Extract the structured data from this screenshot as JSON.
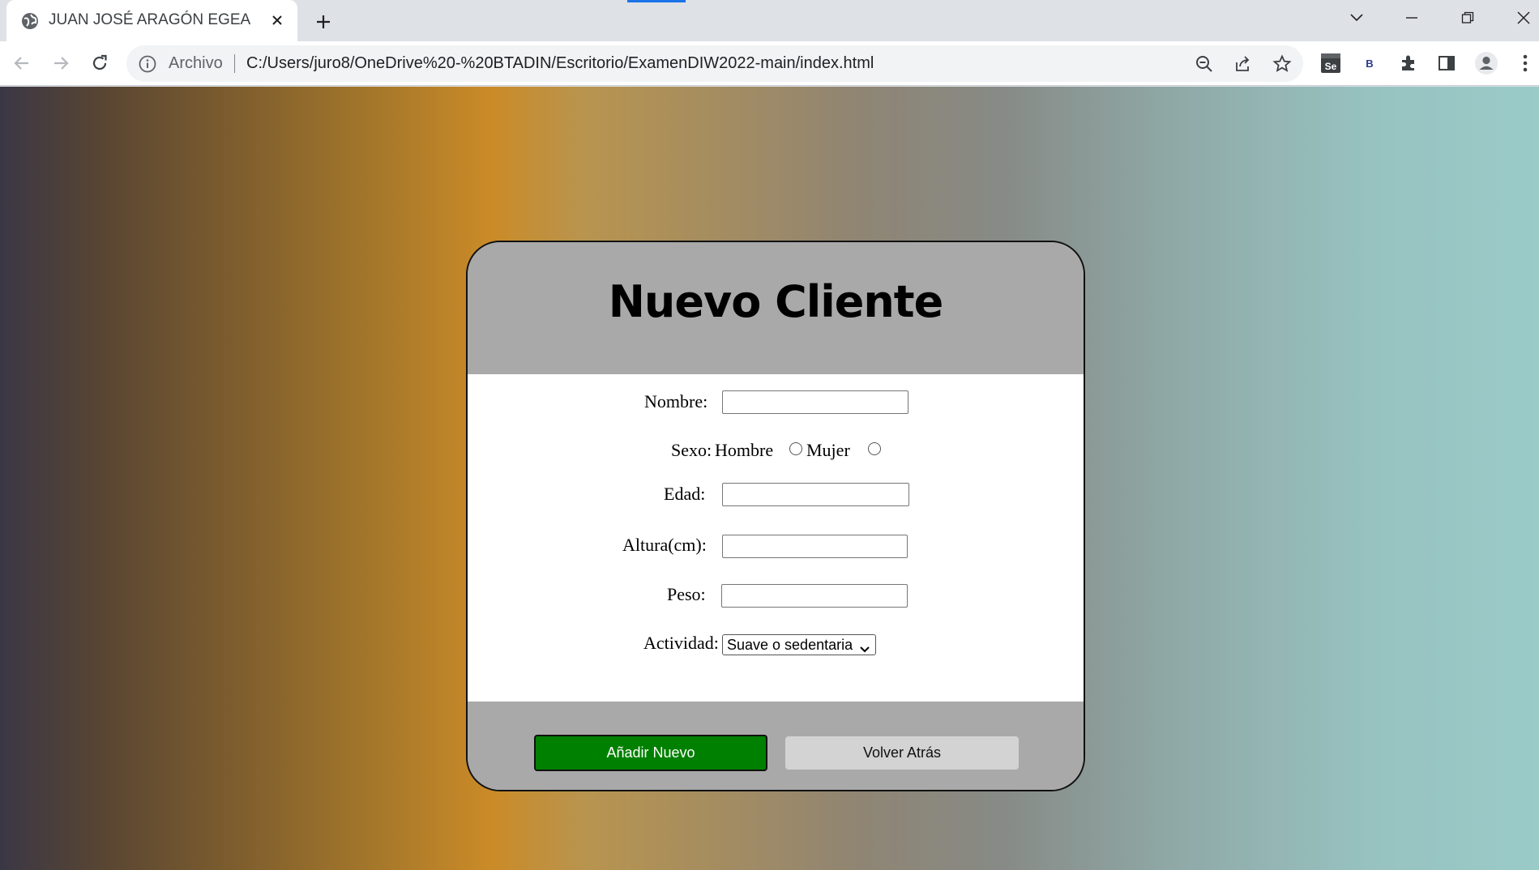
{
  "browser": {
    "tab_title": "JUAN JOSÉ ARAGÓN EGEA",
    "omnibox_label": "Archivo",
    "url": "C:/Users/juro8/OneDrive%20-%20BTADIN/Escritorio/ExamenDIW2022-main/index.html",
    "profile_ext_letter": "B",
    "se_ext_label": "Se"
  },
  "form": {
    "title": "Nuevo Cliente",
    "nombre_label": "Nombre:",
    "nombre_value": "",
    "sexo_label": "Sexo:",
    "sexo_hombre": "Hombre",
    "sexo_mujer": "Mujer",
    "edad_label": "Edad:",
    "edad_value": "",
    "altura_label": "Altura(cm):",
    "altura_value": "",
    "peso_label": "Peso:",
    "peso_value": "",
    "actividad_label": "Actividad:",
    "actividad_selected": "Suave o sedentaria"
  },
  "buttons": {
    "add": "Añadir Nuevo",
    "back": "Volver Atrás"
  },
  "colors": {
    "add_button": "#008000",
    "back_button": "#d3d3d3",
    "card_header": "#a9a9a9"
  }
}
